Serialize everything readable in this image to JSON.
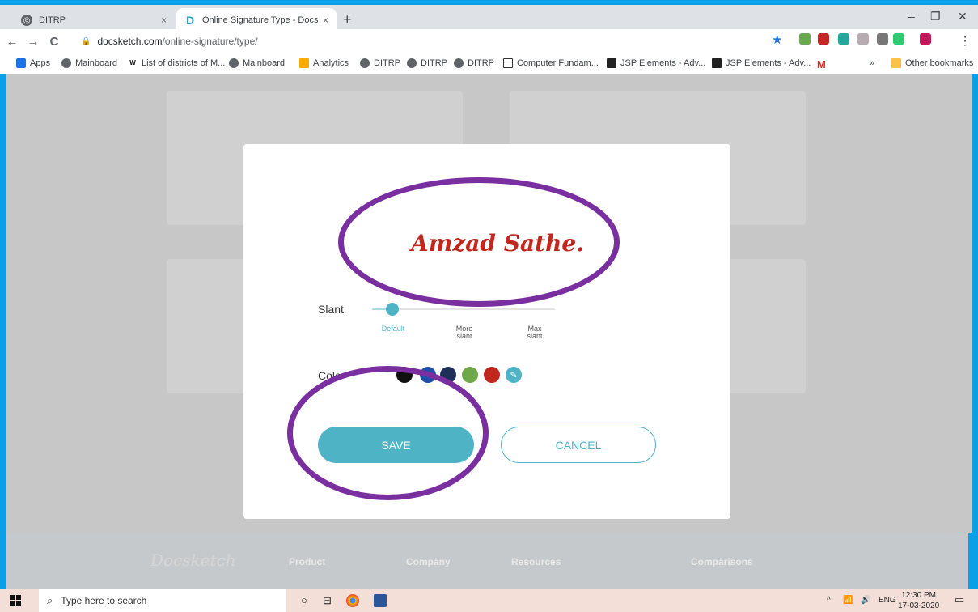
{
  "browser": {
    "tabs": [
      {
        "title": "DITRP",
        "close": "×"
      },
      {
        "title": "Online Signature Type - Docsket",
        "close": "×"
      }
    ],
    "new_tab": "+",
    "window_controls": {
      "minimize": "–",
      "restore": "❐",
      "close": "✕"
    },
    "nav": {
      "back": "←",
      "forward": "→",
      "reload": "C"
    },
    "address": {
      "domain": "docsketch.com",
      "path": "/online-signature/type/"
    },
    "bookmarks": [
      {
        "label": "Apps",
        "icon": "apps-grid-icon"
      },
      {
        "label": "Mainboard",
        "icon": "globe-icon"
      },
      {
        "label": "List of districts of M...",
        "icon": "wikipedia-icon"
      },
      {
        "label": "Mainboard",
        "icon": "globe-icon"
      },
      {
        "label": "Analytics",
        "icon": "analytics-icon"
      },
      {
        "label": "DITRP",
        "icon": "globe-icon"
      },
      {
        "label": "DITRP",
        "icon": "globe-icon"
      },
      {
        "label": "DITRP",
        "icon": "globe-icon"
      },
      {
        "label": "Computer Fundam...",
        "icon": "book-icon"
      },
      {
        "label": "JSP Elements - Adv...",
        "icon": "sf-icon"
      },
      {
        "label": "JSP Elements - Adv...",
        "icon": "sf-icon"
      },
      {
        "label": "M",
        "icon": "gmail-icon"
      }
    ],
    "more_bookmarks": "»",
    "other_bookmarks": "Other bookmarks"
  },
  "modal": {
    "signature_text": "Amzad Sathe.",
    "slant_label": "Slant",
    "slant_options": [
      {
        "label": "Default",
        "selected": true
      },
      {
        "label": "More slant",
        "selected": false
      },
      {
        "label": "Max slant",
        "selected": false
      }
    ],
    "slant_value": 0,
    "color_label": "Colo",
    "colors": [
      "#111111",
      "#1f4fa8",
      "#1e2f5a",
      "#6ea84a",
      "#c0271d"
    ],
    "picker_icon": "eyedropper-icon",
    "save_label": "SAVE",
    "cancel_label": "CANCEL"
  },
  "footer": {
    "brand": "Docsketch",
    "links": [
      "Product",
      "Company",
      "Resources",
      "Comparisons"
    ]
  },
  "taskbar": {
    "search_placeholder": "Type here to search",
    "language": "ENG",
    "time": "12:30 PM",
    "date": "17-03-2020"
  },
  "colors": {
    "accent": "#4fb3c6",
    "annotation": "#7a2fa0",
    "signature": "#c0271d"
  }
}
